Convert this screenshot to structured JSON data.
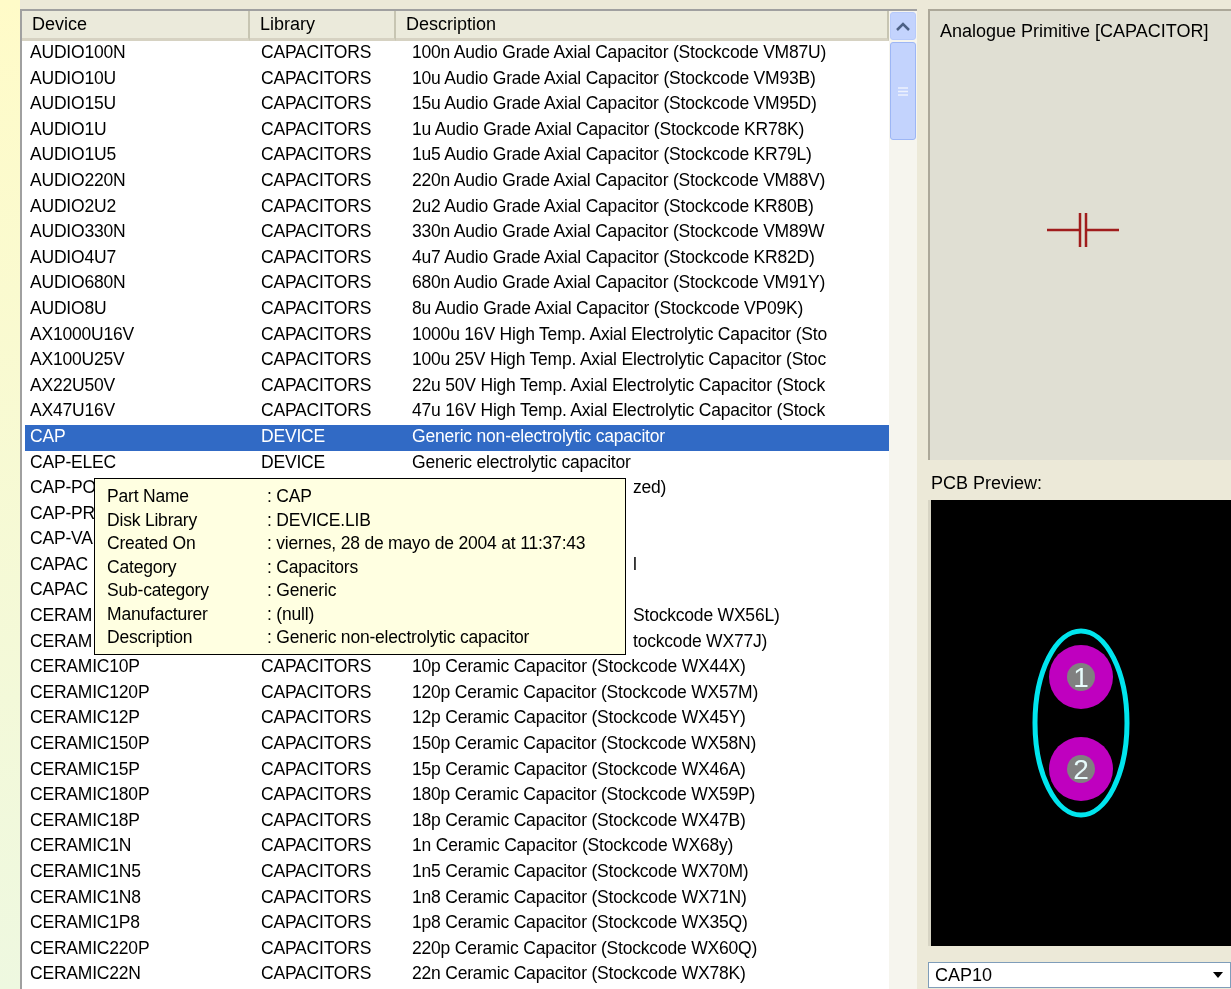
{
  "table": {
    "columns": [
      "Device",
      "Library",
      "Description"
    ],
    "rows": [
      {
        "kind": "full",
        "selected": false,
        "device": "AUDIO100N",
        "library": "CAPACITORS",
        "description": "100n Audio Grade Axial Capacitor (Stockcode VM87U)"
      },
      {
        "kind": "full",
        "selected": false,
        "device": "AUDIO10U",
        "library": "CAPACITORS",
        "description": "10u Audio Grade Axial Capacitor (Stockcode VM93B)"
      },
      {
        "kind": "full",
        "selected": false,
        "device": "AUDIO15U",
        "library": "CAPACITORS",
        "description": "15u Audio Grade Axial Capacitor (Stockcode VM95D)"
      },
      {
        "kind": "full",
        "selected": false,
        "device": "AUDIO1U",
        "library": "CAPACITORS",
        "description": "1u Audio Grade Axial Capacitor (Stockcode KR78K)"
      },
      {
        "kind": "full",
        "selected": false,
        "device": "AUDIO1U5",
        "library": "CAPACITORS",
        "description": "1u5 Audio Grade Axial Capacitor (Stockcode KR79L)"
      },
      {
        "kind": "full",
        "selected": false,
        "device": "AUDIO220N",
        "library": "CAPACITORS",
        "description": "220n Audio Grade Axial Capacitor (Stockcode VM88V)"
      },
      {
        "kind": "full",
        "selected": false,
        "device": "AUDIO2U2",
        "library": "CAPACITORS",
        "description": "2u2 Audio Grade Axial Capacitor (Stockcode KR80B)"
      },
      {
        "kind": "full",
        "selected": false,
        "device": "AUDIO330N",
        "library": "CAPACITORS",
        "description": "330n Audio Grade Axial Capacitor (Stockcode VM89W"
      },
      {
        "kind": "full",
        "selected": false,
        "device": "AUDIO4U7",
        "library": "CAPACITORS",
        "description": "4u7 Audio Grade Axial Capacitor (Stockcode KR82D)"
      },
      {
        "kind": "full",
        "selected": false,
        "device": "AUDIO680N",
        "library": "CAPACITORS",
        "description": "680n Audio Grade Axial Capacitor (Stockcode VM91Y)"
      },
      {
        "kind": "full",
        "selected": false,
        "device": "AUDIO8U",
        "library": "CAPACITORS",
        "description": "8u Audio Grade Axial Capacitor (Stockcode VP09K)"
      },
      {
        "kind": "full",
        "selected": false,
        "device": "AX1000U16V",
        "library": "CAPACITORS",
        "description": "1000u 16V High Temp. Axial Electrolytic Capacitor (Sto"
      },
      {
        "kind": "full",
        "selected": false,
        "device": "AX100U25V",
        "library": "CAPACITORS",
        "description": "100u 25V High Temp. Axial Electrolytic Capacitor (Stoc"
      },
      {
        "kind": "full",
        "selected": false,
        "device": "AX22U50V",
        "library": "CAPACITORS",
        "description": "22u 50V High Temp. Axial Electrolytic Capacitor (Stock"
      },
      {
        "kind": "full",
        "selected": false,
        "device": "AX47U16V",
        "library": "CAPACITORS",
        "description": "47u 16V High Temp. Axial Electrolytic Capacitor (Stock"
      },
      {
        "kind": "full",
        "selected": true,
        "device": "CAP",
        "library": "DEVICE",
        "description": "Generic non-electrolytic capacitor"
      },
      {
        "kind": "full",
        "selected": false,
        "device": "CAP-ELEC",
        "library": "DEVICE",
        "description": "Generic electrolytic capacitor"
      },
      {
        "kind": "covered",
        "selected": false,
        "device": "CAP-PO",
        "description": "zed)"
      },
      {
        "kind": "covered",
        "selected": false,
        "device": "CAP-PR"
      },
      {
        "kind": "covered",
        "selected": false,
        "device": "CAP-VA"
      },
      {
        "kind": "covered",
        "selected": false,
        "device": "CAPAC",
        "description": "l"
      },
      {
        "kind": "covered",
        "selected": false,
        "device": "CAPAC"
      },
      {
        "kind": "covered",
        "selected": false,
        "device": "CERAM",
        "description": "Stockcode WX56L)"
      },
      {
        "kind": "covered",
        "selected": false,
        "device": "CERAM",
        "description": "tockcode WX77J)"
      },
      {
        "kind": "full",
        "selected": false,
        "device": "CERAMIC10P",
        "library": "CAPACITORS",
        "description": "10p Ceramic Capacitor (Stockcode WX44X)"
      },
      {
        "kind": "full",
        "selected": false,
        "device": "CERAMIC120P",
        "library": "CAPACITORS",
        "description": "120p Ceramic Capacitor (Stockcode WX57M)"
      },
      {
        "kind": "full",
        "selected": false,
        "device": "CERAMIC12P",
        "library": "CAPACITORS",
        "description": "12p Ceramic Capacitor (Stockcode WX45Y)"
      },
      {
        "kind": "full",
        "selected": false,
        "device": "CERAMIC150P",
        "library": "CAPACITORS",
        "description": "150p Ceramic Capacitor (Stockcode WX58N)"
      },
      {
        "kind": "full",
        "selected": false,
        "device": "CERAMIC15P",
        "library": "CAPACITORS",
        "description": "15p Ceramic Capacitor (Stockcode WX46A)"
      },
      {
        "kind": "full",
        "selected": false,
        "device": "CERAMIC180P",
        "library": "CAPACITORS",
        "description": "180p Ceramic Capacitor (Stockcode WX59P)"
      },
      {
        "kind": "full",
        "selected": false,
        "device": "CERAMIC18P",
        "library": "CAPACITORS",
        "description": "18p Ceramic Capacitor (Stockcode WX47B)"
      },
      {
        "kind": "full",
        "selected": false,
        "device": "CERAMIC1N",
        "library": "CAPACITORS",
        "description": "1n Ceramic Capacitor (Stockcode WX68y)"
      },
      {
        "kind": "full",
        "selected": false,
        "device": "CERAMIC1N5",
        "library": "CAPACITORS",
        "description": "1n5 Ceramic Capacitor (Stockcode WX70M)"
      },
      {
        "kind": "full",
        "selected": false,
        "device": "CERAMIC1N8",
        "library": "CAPACITORS",
        "description": "1n8 Ceramic Capacitor (Stockcode WX71N)"
      },
      {
        "kind": "full",
        "selected": false,
        "device": "CERAMIC1P8",
        "library": "CAPACITORS",
        "description": "1p8 Ceramic Capacitor (Stockcode WX35Q)"
      },
      {
        "kind": "full",
        "selected": false,
        "device": "CERAMIC220P",
        "library": "CAPACITORS",
        "description": "220p Ceramic Capacitor (Stockcode WX60Q)"
      },
      {
        "kind": "full",
        "selected": false,
        "device": "CERAMIC22N",
        "library": "CAPACITORS",
        "description": "22n Ceramic Capacitor (Stockcode WX78K)"
      }
    ]
  },
  "tooltip": {
    "rows": [
      {
        "label": "Part Name",
        "value": ": CAP"
      },
      {
        "label": "Disk Library",
        "value": ": DEVICE.LIB"
      },
      {
        "label": "Created On",
        "value": ": viernes, 28 de mayo de 2004 at 11:37:43"
      },
      {
        "label": "Category",
        "value": ": Capacitors"
      },
      {
        "label": "Sub-category",
        "value": ": Generic"
      },
      {
        "label": "Manufacturer",
        "value": ": (null)"
      },
      {
        "label": "Description",
        "value": ": Generic non-electrolytic capacitor"
      }
    ]
  },
  "schematic_preview": {
    "title": "Analogue Primitive [CAPACITOR]"
  },
  "pcb_preview": {
    "label": "PCB Preview:",
    "pads": [
      "1",
      "2"
    ]
  },
  "package_select": {
    "value": "CAP10"
  }
}
